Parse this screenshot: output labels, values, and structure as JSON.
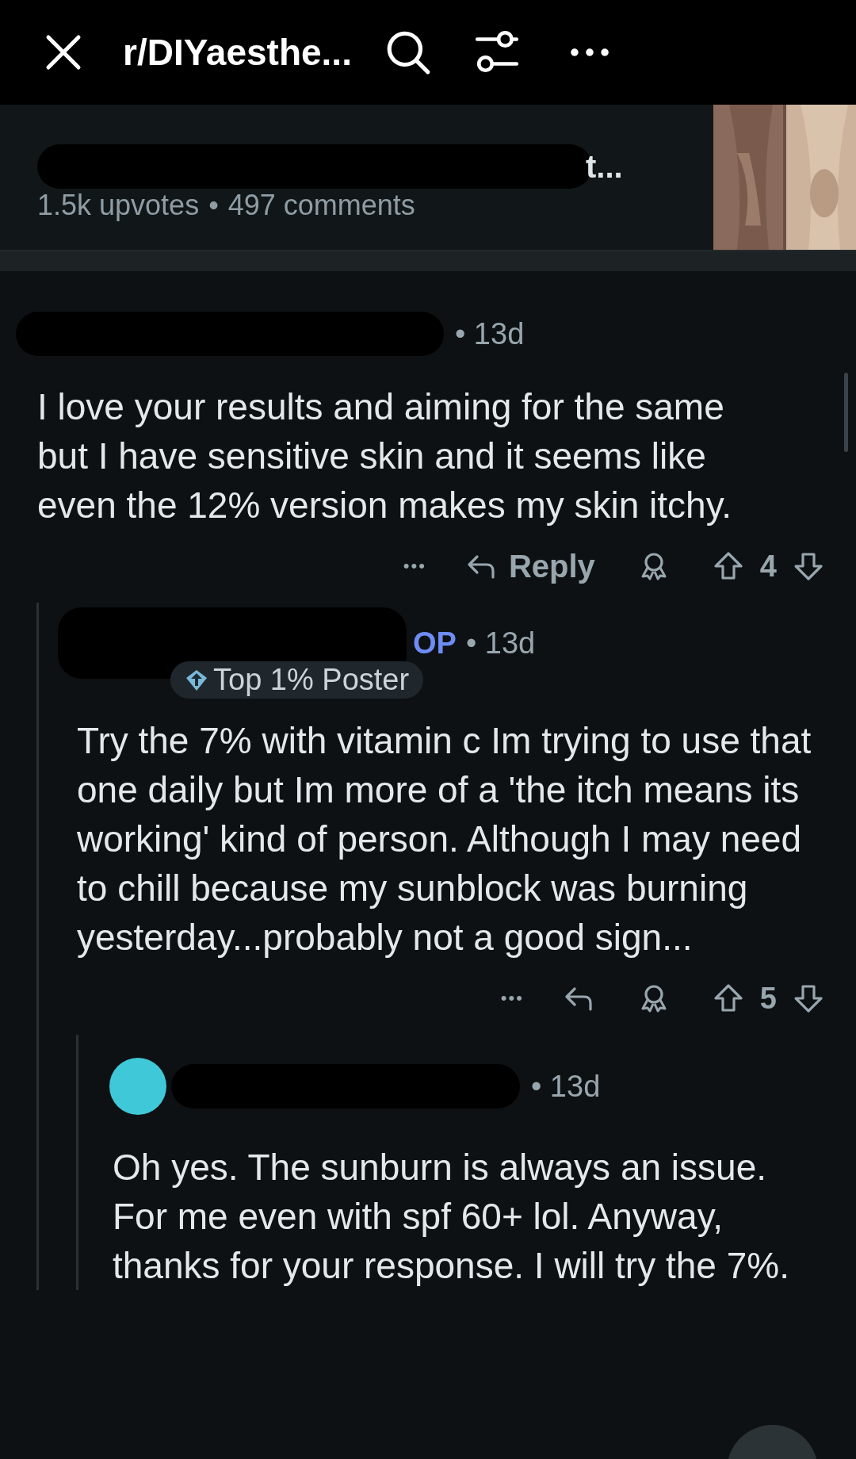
{
  "top_bar": {
    "subreddit": "r/DIYaesthe..."
  },
  "post": {
    "title_tail": "t...",
    "upvotes": "1.5k upvotes",
    "separator": "•",
    "comments": "497 comments"
  },
  "comments": [
    {
      "avatar": false,
      "is_op": false,
      "time": "• 13d",
      "body": "I love your results and aiming for the same but I have sensitive skin and it seems like even the 12% version makes my skin itchy.",
      "more": "•••",
      "reply_label": "Reply",
      "votes": "4",
      "children": [
        {
          "avatar": false,
          "is_op": true,
          "op_label": "OP",
          "badge": "Top 1% Poster",
          "time": "• 13d",
          "body": "Try the 7% with vitamin c Im trying to use that one daily but Im more of a 'the itch means its working' kind of person. Although I may need to chill because my sunblock was burning yesterday...probably not a good sign...",
          "more": "•••",
          "votes": "5",
          "children": [
            {
              "avatar": true,
              "is_op": false,
              "time": "• 13d",
              "body": "Oh yes. The sunburn is always an issue. For me even with spf 60+ lol. Anyway, thanks for your response. I will try the 7%."
            }
          ]
        }
      ]
    }
  ]
}
